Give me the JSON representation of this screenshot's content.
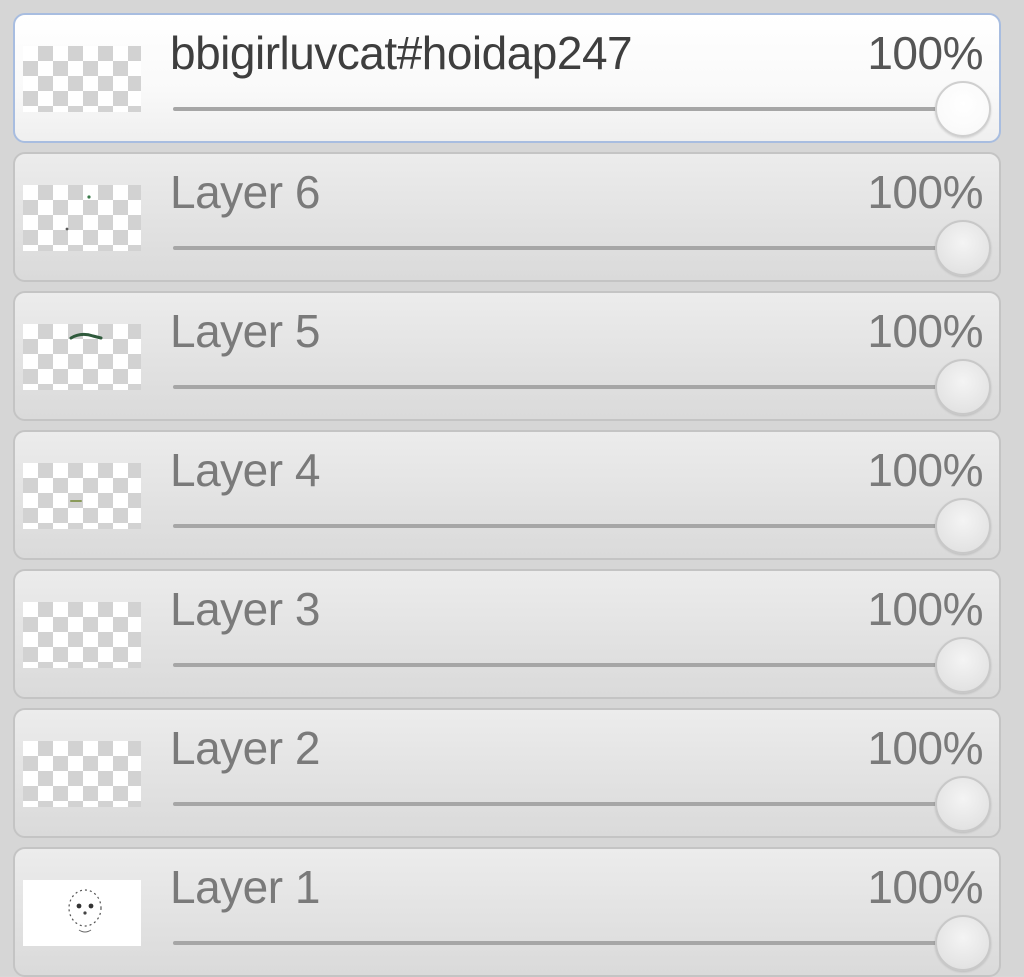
{
  "layers": [
    {
      "name": "bbigirluvcat#hoidap247",
      "opacity_label": "100%",
      "opacity": 1.0,
      "selected": true,
      "thumb": "transparent-empty"
    },
    {
      "name": "Layer 6",
      "opacity_label": "100%",
      "opacity": 1.0,
      "selected": false,
      "thumb": "transparent-dots"
    },
    {
      "name": "Layer 5",
      "opacity_label": "100%",
      "opacity": 1.0,
      "selected": false,
      "thumb": "transparent-stroke"
    },
    {
      "name": "Layer 4",
      "opacity_label": "100%",
      "opacity": 1.0,
      "selected": false,
      "thumb": "transparent-small-mark"
    },
    {
      "name": "Layer 3",
      "opacity_label": "100%",
      "opacity": 1.0,
      "selected": false,
      "thumb": "transparent-empty"
    },
    {
      "name": "Layer 2",
      "opacity_label": "100%",
      "opacity": 1.0,
      "selected": false,
      "thumb": "transparent-empty"
    },
    {
      "name": "Layer 1",
      "opacity_label": "100%",
      "opacity": 1.0,
      "selected": false,
      "thumb": "white-sketch"
    }
  ]
}
